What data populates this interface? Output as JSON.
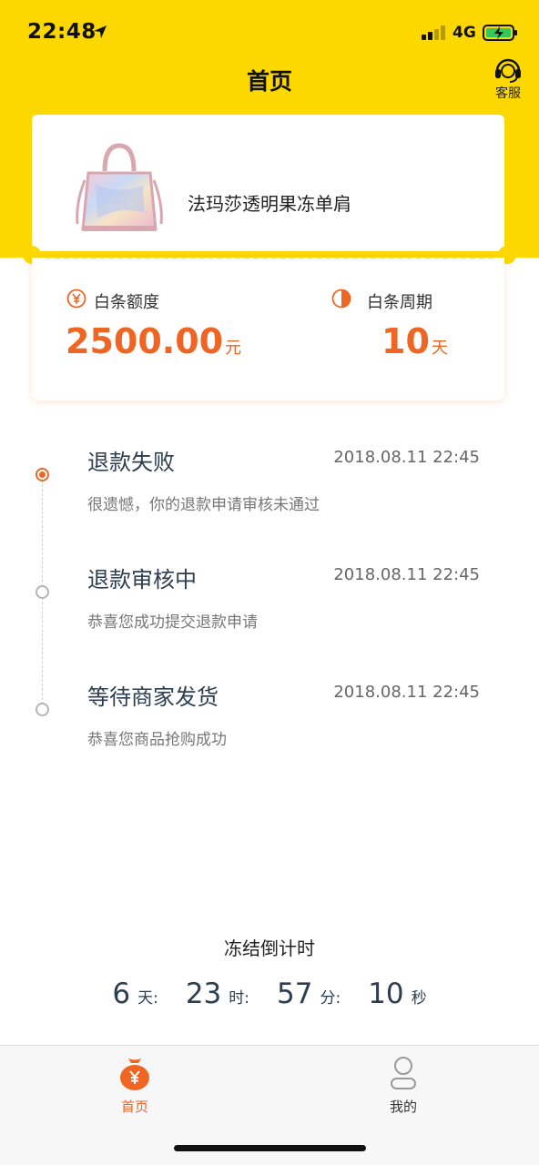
{
  "status_bar": {
    "time": "22:48",
    "network": "4G"
  },
  "header": {
    "title": "首页",
    "service_label": "客服"
  },
  "product": {
    "name": "法玛莎透明果冻单肩"
  },
  "credit": {
    "quota_label": "白条额度",
    "quota_amount": "2500.00",
    "quota_unit": "元",
    "cycle_label": "白条周期",
    "cycle_value": "10",
    "cycle_unit": "天"
  },
  "timeline": [
    {
      "title": "退款失败",
      "time": "2018.08.11 22:45",
      "desc": "很遗憾，你的退款申请审核未通过",
      "active": true
    },
    {
      "title": "退款审核中",
      "time": "2018.08.11 22:45",
      "desc": "恭喜您成功提交退款申请",
      "active": false
    },
    {
      "title": "等待商家发货",
      "time": "2018.08.11 22:45",
      "desc": "恭喜您商品抢购成功",
      "active": false
    }
  ],
  "countdown": {
    "title": "冻结倒计时",
    "days": "6",
    "days_unit": "天:",
    "hours": "23",
    "hours_unit": "时:",
    "minutes": "57",
    "minutes_unit": "分:",
    "seconds": "10",
    "seconds_unit": "秒"
  },
  "tabs": [
    {
      "label": "首页",
      "icon": "money-bag-icon",
      "active": true
    },
    {
      "label": "我的",
      "icon": "user-icon",
      "active": false
    }
  ],
  "colors": {
    "brand_yellow": "#fcd800",
    "accent_orange": "#ef6524"
  }
}
